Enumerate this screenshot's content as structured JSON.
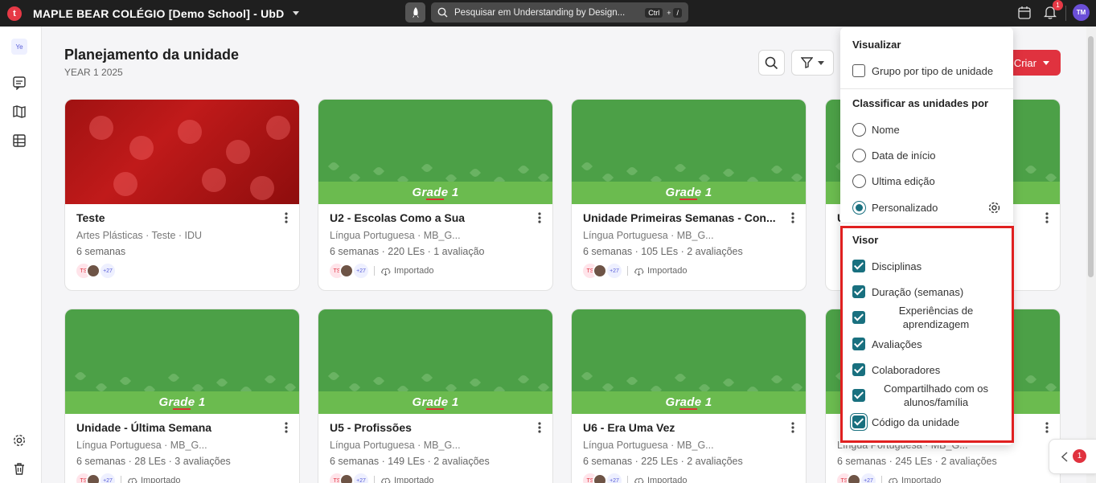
{
  "topbar": {
    "logo_letter": "t",
    "school_name": "MAPLE BEAR COLÉGIO [Demo School] - UbD",
    "search_placeholder": "Pesquisar em Understanding by Design...",
    "shortcut_ctrl": "Ctrl",
    "shortcut_plus": "+",
    "shortcut_key": "/",
    "notification_count": "1",
    "user_initials": "TM"
  },
  "rail": {
    "year_badge": "Ye",
    "icons": [
      "chat-icon",
      "book-icon",
      "table-icon",
      "gear-icon",
      "trash-icon"
    ]
  },
  "header": {
    "title": "Planejamento da unidade",
    "subtitle": "YEAR 1 2025",
    "create_label": "Criar"
  },
  "cards": [
    {
      "title": "Teste",
      "subject": "Artes Plásticas · Teste · IDU",
      "meta": "6 semanas",
      "banner": "photo",
      "tag": "",
      "more": "+27",
      "ts": "TS"
    },
    {
      "title": "U2 - Escolas Como a Sua",
      "subject": "Língua Portuguesa · MB_G...",
      "meta": "6 semanas · 220 LEs · 1 avaliação",
      "banner": "grade",
      "tag": "Importado",
      "more": "+27",
      "ts": "TS"
    },
    {
      "title": "Unidade Primeiras Semanas - Con...",
      "subject": "Língua Portuguesa · MB_G...",
      "meta": "6 semanas · 105 LEs · 2 avaliações",
      "banner": "grade",
      "tag": "Importado",
      "more": "+27",
      "ts": "TS"
    },
    {
      "title": "U",
      "subject": "",
      "meta": "",
      "banner": "grade",
      "tag": "",
      "more": "",
      "ts": ""
    },
    {
      "title": "Unidade - Última Semana",
      "subject": "Língua Portuguesa · MB_G...",
      "meta": "6 semanas · 28 LEs · 3 avaliações",
      "banner": "grade",
      "tag": "Importado",
      "more": "+27",
      "ts": "TS"
    },
    {
      "title": "U5 - Profissões",
      "subject": "Língua Portuguesa · MB_G...",
      "meta": "6 semanas · 149 LEs · 2 avaliações",
      "banner": "grade",
      "tag": "Importado",
      "more": "+27",
      "ts": "TS"
    },
    {
      "title": "U6 - Era Uma Vez",
      "subject": "Língua Portuguesa · MB_G...",
      "meta": "6 semanas · 225 LEs · 2 avaliações",
      "banner": "grade",
      "tag": "Importado",
      "more": "+27",
      "ts": "TS"
    },
    {
      "title": "",
      "subject": "Língua Portuguesa · MB_G...",
      "meta": "6 semanas · 245 LEs · 2 avaliações",
      "banner": "grade",
      "tag": "Importado",
      "more": "+27",
      "ts": "TS"
    }
  ],
  "grade_label": "Grade 1",
  "panel": {
    "view_heading": "Visualizar",
    "group_label": "Grupo por tipo de unidade",
    "sort_heading": "Classificar as unidades por",
    "sort_options": [
      "Nome",
      "Data de início",
      "Ultima edição",
      "Personalizado"
    ],
    "sort_selected": "Personalizado",
    "visor_heading": "Visor",
    "visor_options": [
      "Disciplinas",
      "Duração (semanas)",
      "Experiências de aprendizagem",
      "Avaliações",
      "Colaboradores",
      "Compartilhado com os alunos/família",
      "Código da unidade"
    ]
  },
  "side_tab": {
    "badge": "1"
  },
  "colors": {
    "accent": "#19707f",
    "brand_red": "#e0323f",
    "card_green": "#4ca047"
  }
}
